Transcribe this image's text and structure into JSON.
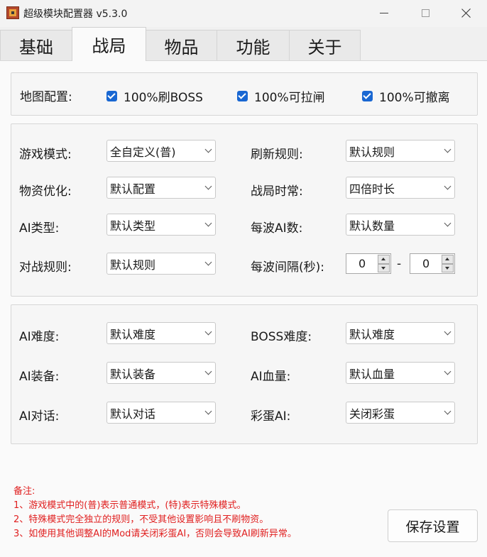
{
  "window": {
    "title": "超级模块配置器 v5.3.0",
    "icon": "app-icon"
  },
  "tabs": [
    {
      "label": "基础",
      "active": false
    },
    {
      "label": "战局",
      "active": true
    },
    {
      "label": "物品",
      "active": false
    },
    {
      "label": "功能",
      "active": false
    },
    {
      "label": "关于",
      "active": false
    }
  ],
  "map_config": {
    "label": "地图配置:",
    "checks": [
      {
        "label": "100%刷BOSS",
        "checked": true
      },
      {
        "label": "100%可拉闸",
        "checked": true
      },
      {
        "label": "100%可撤离",
        "checked": true
      }
    ]
  },
  "battle": {
    "game_mode": {
      "label": "游戏模式:",
      "value": "全自定义(普)"
    },
    "refresh_rule": {
      "label": "刷新规则:",
      "value": "默认规则"
    },
    "supply_opt": {
      "label": "物资优化:",
      "value": "默认配置"
    },
    "battle_time": {
      "label": "战局时常:",
      "value": "四倍时长"
    },
    "ai_type": {
      "label": "AI类型:",
      "value": "默认类型"
    },
    "wave_count": {
      "label": "每波AI数:",
      "value": "默认数量"
    },
    "combat_rule": {
      "label": "对战规则:",
      "value": "默认规则"
    },
    "wave_interval": {
      "label": "每波间隔(秒):",
      "min": "0",
      "separator": "-",
      "max": "0"
    }
  },
  "ai": {
    "difficulty": {
      "label": "AI难度:",
      "value": "默认难度"
    },
    "boss_difficulty": {
      "label": "BOSS难度:",
      "value": "默认难度"
    },
    "equipment": {
      "label": "AI装备:",
      "value": "默认装备"
    },
    "health": {
      "label": "AI血量:",
      "value": "默认血量"
    },
    "dialog": {
      "label": "AI对话:",
      "value": "默认对话"
    },
    "easter_egg": {
      "label": "彩蛋AI:",
      "value": "关闭彩蛋"
    }
  },
  "notes": {
    "title": "备注:",
    "lines": [
      "1、游戏模式中的(普)表示普通模式，(特)表示特殊模式。",
      "2、特殊模式完全独立的规则，不受其他设置影响且不刷物资。",
      "3、如使用其他调整AI的Mod请关闭彩蛋AI，否则会导致AI刷新异常。"
    ]
  },
  "save_button": "保存设置",
  "colors": {
    "accent": "#1967d2",
    "note_text": "#e02020"
  }
}
